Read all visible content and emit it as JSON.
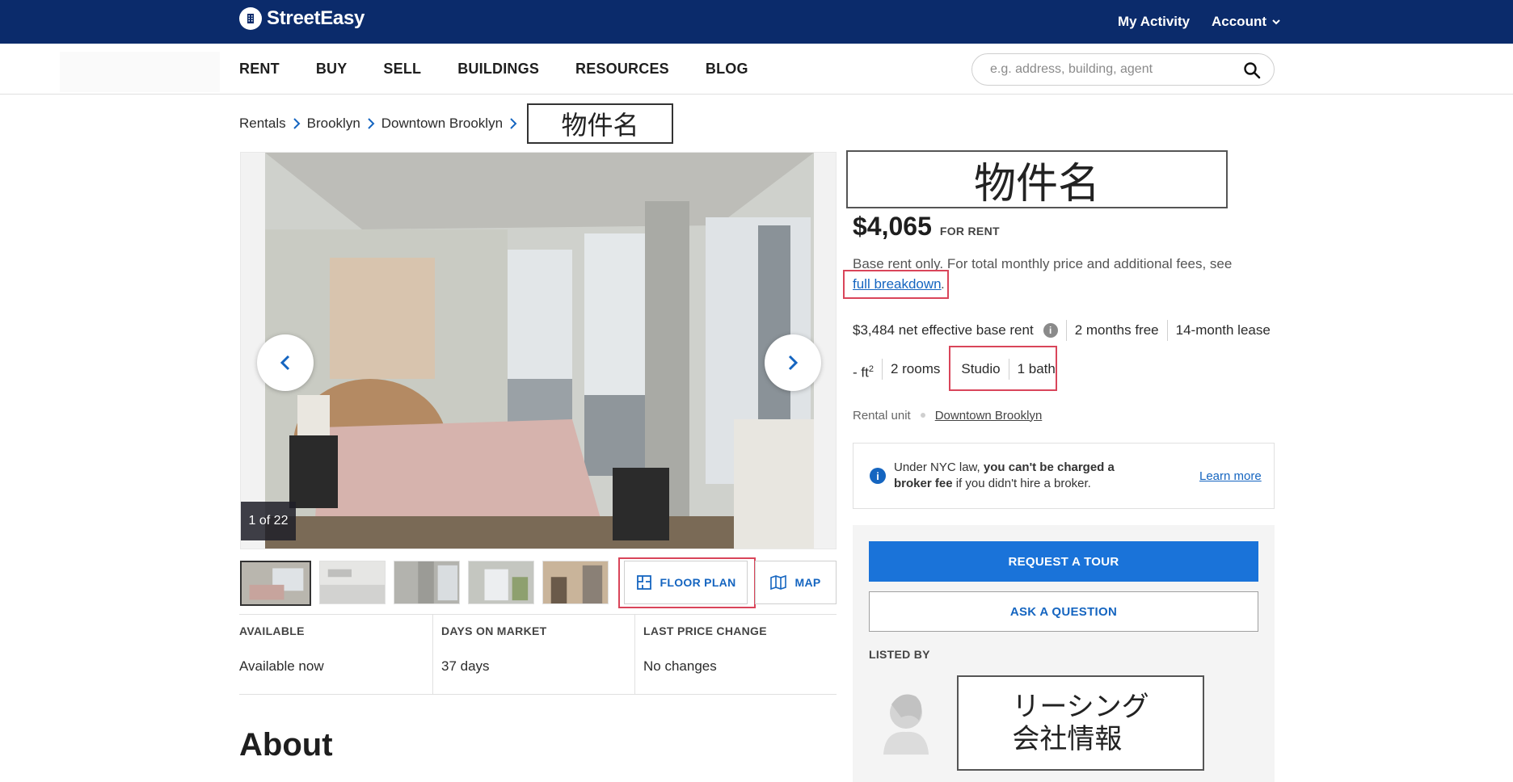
{
  "brand": {
    "name": "StreetEasy"
  },
  "topbar": {
    "my_activity": "My Activity",
    "account": "Account"
  },
  "nav": {
    "items": [
      "RENT",
      "BUY",
      "SELL",
      "BUILDINGS",
      "RESOURCES",
      "BLOG"
    ]
  },
  "search": {
    "placeholder": "e.g. address, building, agent",
    "value": ""
  },
  "breadcrumb": {
    "items": [
      "Rentals",
      "Brooklyn",
      "Downtown Brooklyn"
    ],
    "current": "物件名"
  },
  "gallery": {
    "counter": "1 of 22",
    "thumbnail_count": 5
  },
  "media": {
    "floor_plan": "FLOOR PLAN",
    "map": "MAP"
  },
  "stats": [
    {
      "label": "AVAILABLE",
      "value": "Available now"
    },
    {
      "label": "DAYS ON MARKET",
      "value": "37 days"
    },
    {
      "label": "LAST PRICE CHANGE",
      "value": "No changes"
    }
  ],
  "about": {
    "heading": "About"
  },
  "listing": {
    "title": "物件名",
    "price": "$4,065",
    "price_type": "FOR RENT",
    "base_note": "Base rent only. For total monthly price and additional fees, see",
    "breakdown_link": "full breakdown",
    "breakdown_period": ".",
    "net_effective": "$3,484 net effective base rent",
    "months_free": "2 months free",
    "lease": "14-month lease",
    "sqft_prefix": "- ft",
    "sqft_sup": "2",
    "rooms": "2 rooms",
    "beds": "Studio",
    "baths": "1 bath",
    "unit_type": "Rental unit",
    "neighborhood": "Downtown Brooklyn"
  },
  "notice": {
    "prefix": "Under NYC law,",
    "bold": "you can't be charged a broker fee",
    "suffix": "if you didn't hire a broker.",
    "learn_more": "Learn more"
  },
  "contact": {
    "tour_button": "REQUEST A TOUR",
    "ask_button": "ASK A QUESTION",
    "listed_by": "LISTED BY",
    "agent_info": "リーシング\n会社情報"
  },
  "colors": {
    "topbar": "#0b2b6b",
    "accent": "#1a73d9",
    "link": "#1565c0",
    "highlight": "#d9455a"
  }
}
